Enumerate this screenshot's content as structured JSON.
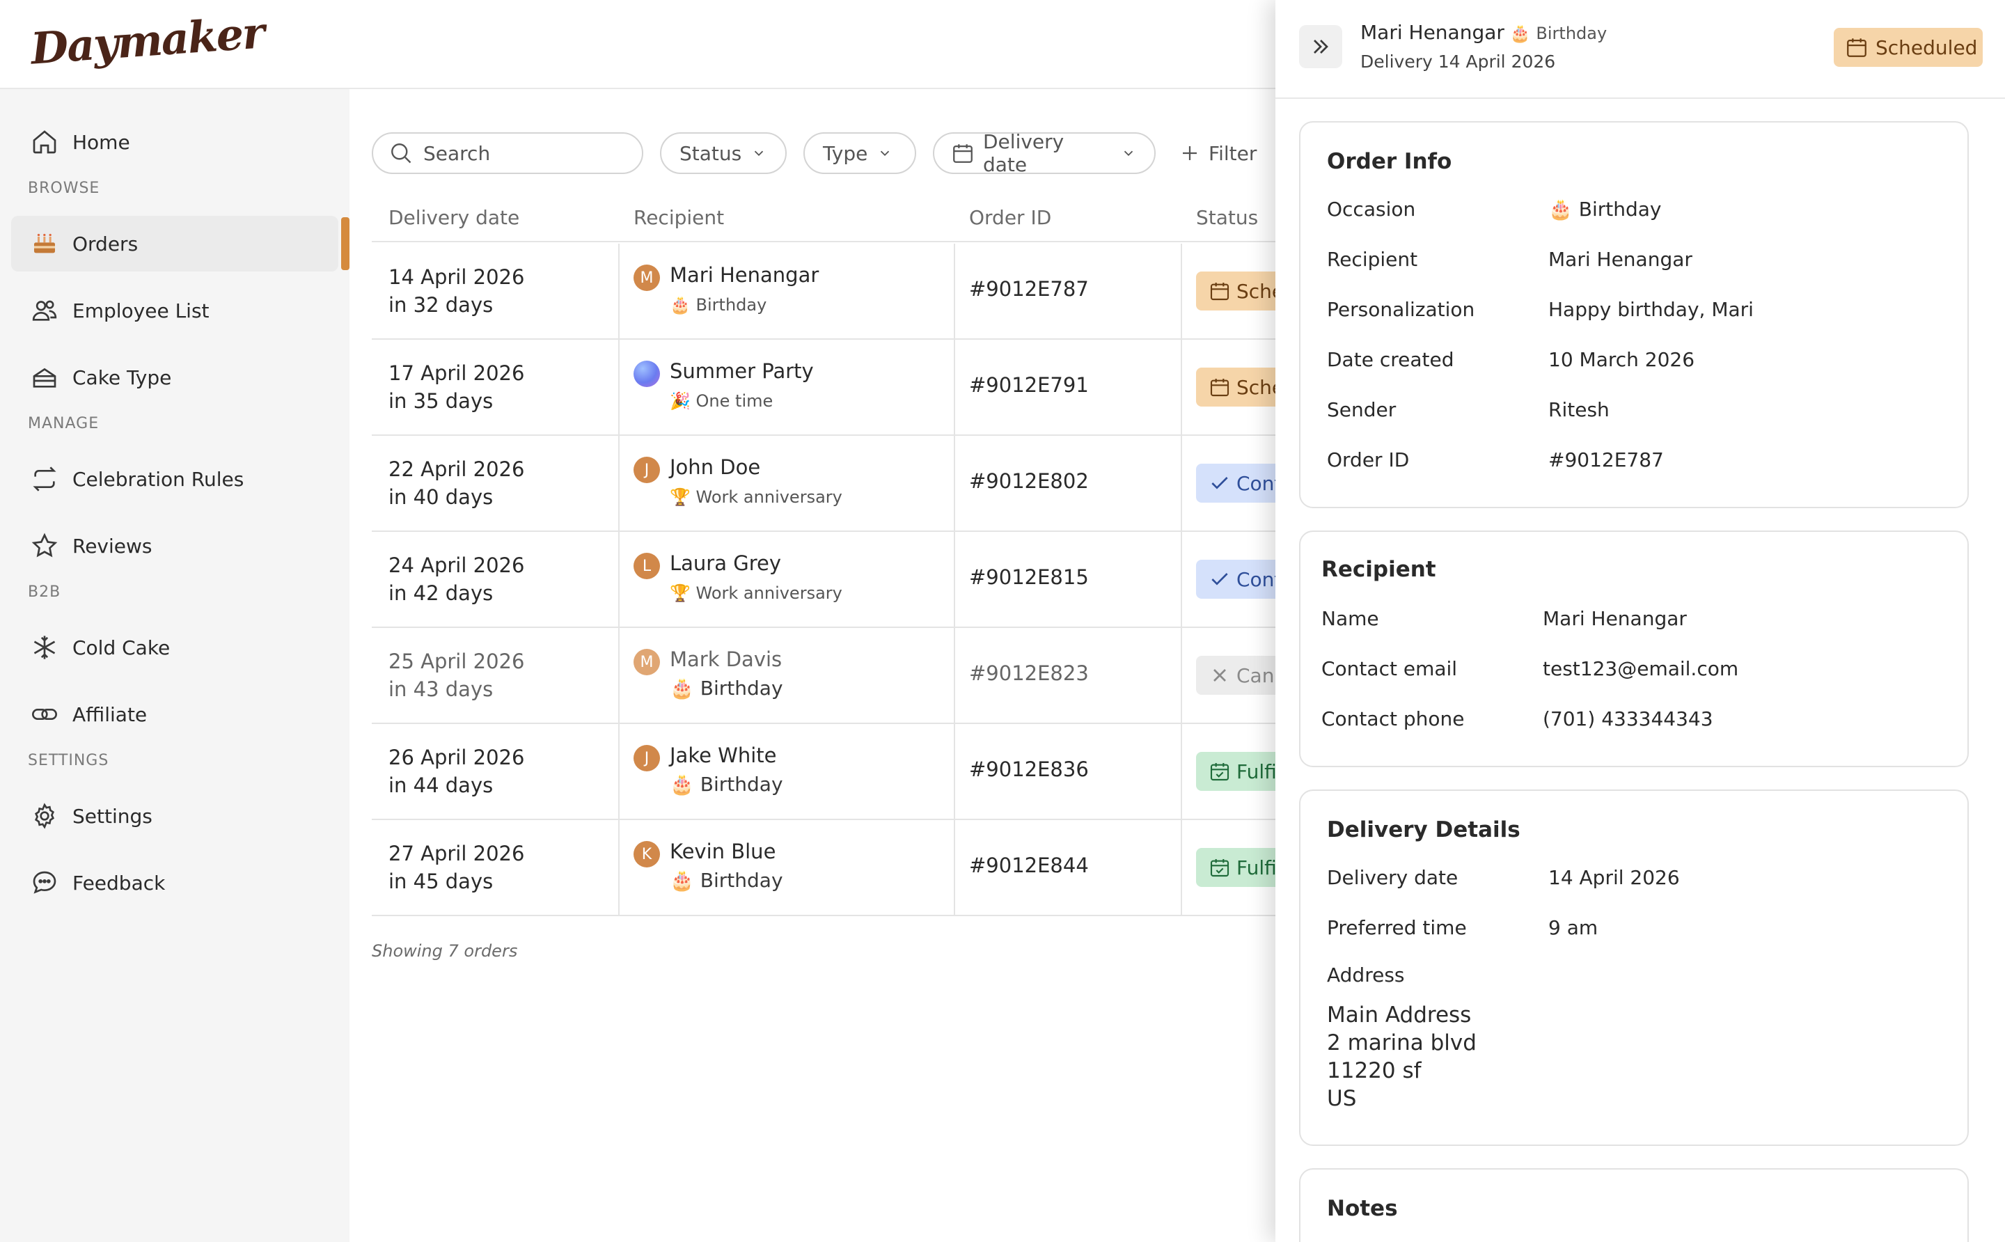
{
  "brand": {
    "logo": "Daymaker",
    "accent": "#d58a3e"
  },
  "sidebar": {
    "items": [
      {
        "label": "Home",
        "icon": "home-icon"
      },
      {
        "section": "BROWSE"
      },
      {
        "label": "Orders",
        "icon": "cake-icon",
        "active": true
      },
      {
        "label": "Employee List",
        "icon": "users-icon"
      },
      {
        "label": "Cake Type",
        "icon": "cake-slice-icon"
      },
      {
        "section": "MANAGE"
      },
      {
        "label": "Celebration Rules",
        "icon": "repeat-icon"
      },
      {
        "label": "Reviews",
        "icon": "star-icon"
      },
      {
        "section": "B2B"
      },
      {
        "label": "Cold Cake",
        "icon": "snowflake-icon"
      },
      {
        "label": "Affiliate",
        "icon": "link-icon"
      },
      {
        "section": "SETTINGS"
      },
      {
        "label": "Settings",
        "icon": "gear-icon"
      },
      {
        "label": "Feedback",
        "icon": "chat-icon"
      }
    ]
  },
  "toolbar": {
    "search_placeholder": "Search",
    "status_label": "Status",
    "type_label": "Type",
    "delivery_label": "Delivery date",
    "filter_label": "Filter"
  },
  "table": {
    "headers": [
      "Delivery date",
      "Recipient",
      "Order ID",
      "Status"
    ],
    "rows": [
      {
        "date": "14 April 2026",
        "rel": "in 32 days",
        "initial": "M",
        "avatar": "#d1884a",
        "name": "Mari Henangar",
        "type_emoji": "🎂",
        "type": "Birthday",
        "order": "#9012E787",
        "status": "Scheduled",
        "status_kind": "scheduled"
      },
      {
        "date": "17 April 2026",
        "rel": "in 35 days",
        "initial": "",
        "avatar": "gradient",
        "name": "Summer Party",
        "type_emoji": "🎉",
        "type": "One time",
        "order": "#9012E791",
        "status": "Scheduled",
        "status_kind": "scheduled"
      },
      {
        "date": "22 April 2026",
        "rel": "in 40 days",
        "initial": "J",
        "avatar": "#d1884a",
        "name": "John Doe",
        "type_emoji": "🏆",
        "type": "Work anniversary",
        "order": "#9012E802",
        "status": "Confirmed",
        "status_kind": "confirmed"
      },
      {
        "date": "24 April 2026",
        "rel": "in 42 days",
        "initial": "L",
        "avatar": "#d1884a",
        "name": "Laura Grey",
        "type_emoji": "🏆",
        "type": "Work anniversary",
        "order": "#9012E815",
        "status": "Confirmed",
        "status_kind": "confirmed"
      },
      {
        "date": "25 April 2026",
        "rel": "in 43 days",
        "initial": "M",
        "avatar": "#e0a673",
        "name": "Mark Davis",
        "type_emoji": "🎂",
        "type": "Birthday",
        "order": "#9012E823",
        "status": "Cancelled",
        "status_kind": "cancelled"
      },
      {
        "date": "26 April 2026",
        "rel": "in 44 days",
        "initial": "J",
        "avatar": "#d1884a",
        "name": "Jake White",
        "type_emoji": "🎂",
        "type": "Birthday",
        "order": "#9012E836",
        "status": "Fulfilled",
        "status_kind": "fulfilled"
      },
      {
        "date": "27 April 2026",
        "rel": "in 45 days",
        "initial": "K",
        "avatar": "#d1884a",
        "name": "Kevin Blue",
        "type_emoji": "🎂",
        "type": "Birthday",
        "order": "#9012E844",
        "status": "Fulfilled",
        "status_kind": "fulfilled"
      }
    ],
    "footer": "Showing 7 orders"
  },
  "drawer": {
    "name": "Mari Henangar",
    "occasion": "🎂 Birthday",
    "subtitle": "Delivery 14 April 2026",
    "status": "Scheduled",
    "order_info": {
      "title": "Order Info",
      "rows": [
        {
          "k": "Occasion",
          "v": "🎂 Birthday"
        },
        {
          "k": "Recipient",
          "v": "Mari Henangar"
        },
        {
          "k": "Personalization",
          "v": "Happy birthday, Mari"
        },
        {
          "k": "Date created",
          "v": "10 March 2026"
        },
        {
          "k": "Sender",
          "v": "Ritesh"
        },
        {
          "k": "Order ID",
          "v": "#9012E787"
        }
      ]
    },
    "recipient": {
      "title": "Recipient",
      "rows": [
        {
          "k": "Name",
          "v": "Mari Henangar"
        },
        {
          "k": "Contact email",
          "v": "test123@email.com"
        },
        {
          "k": "Contact phone",
          "v": "(701) 433344343"
        }
      ]
    },
    "delivery": {
      "title": "Delivery Details",
      "rows": [
        {
          "k": "Delivery date",
          "v": "14 April 2026"
        },
        {
          "k": "Preferred time",
          "v": "9 am"
        }
      ],
      "address_label": "Address",
      "address_lines": [
        "Main Address",
        "2 marina blvd",
        "11220 sf",
        "US"
      ]
    },
    "notes": {
      "title": "Notes"
    }
  },
  "status_colors": {
    "scheduled": {
      "bg": "#f6d5a9",
      "fg": "#6a3e12"
    },
    "confirmed": {
      "bg": "#d5e1fb",
      "fg": "#2f4f9a"
    },
    "cancelled": {
      "bg": "#ececec",
      "fg": "#8a8a8a"
    },
    "fulfilled": {
      "bg": "#c9ebd3",
      "fg": "#1f6b3a"
    }
  }
}
